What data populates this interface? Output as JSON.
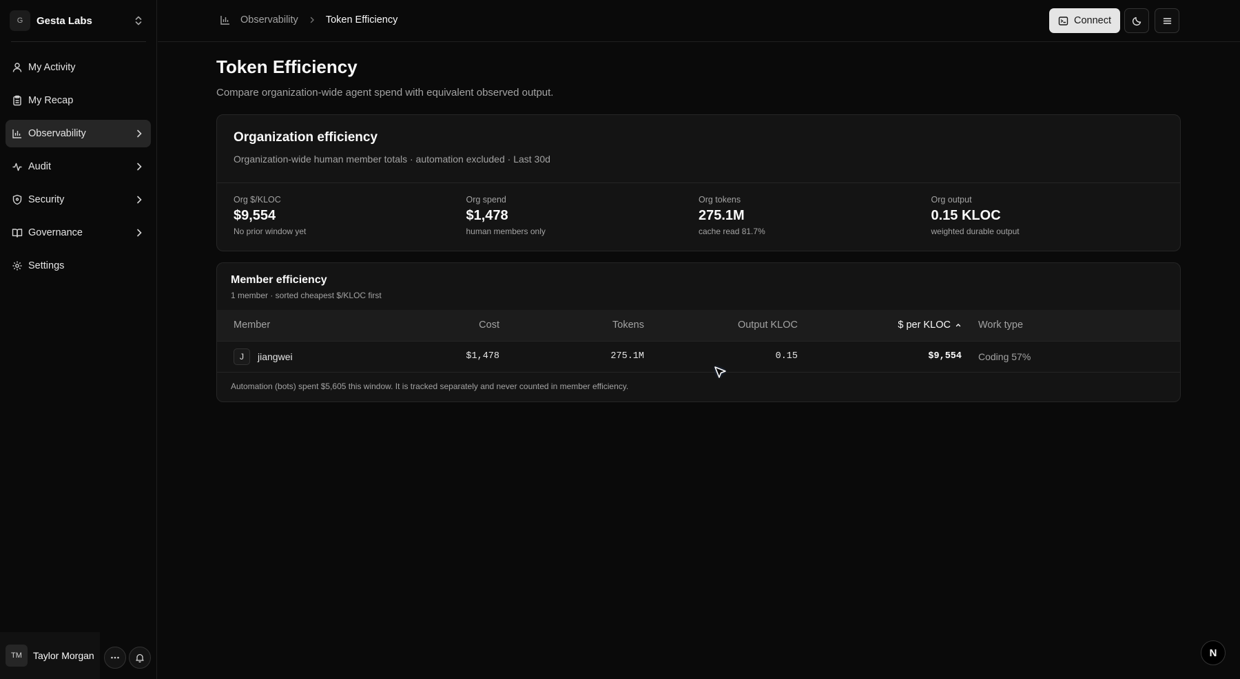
{
  "org": {
    "initial": "G",
    "name": "Gesta Labs"
  },
  "sidebar": {
    "items": [
      {
        "label": "My Activity",
        "icon": "user-icon"
      },
      {
        "label": "My Recap",
        "icon": "clipboard-icon"
      },
      {
        "label": "Observability",
        "icon": "bar-chart-icon",
        "active": true
      },
      {
        "label": "Audit",
        "icon": "activity-icon"
      },
      {
        "label": "Security",
        "icon": "shield-icon"
      },
      {
        "label": "Governance",
        "icon": "book-open-icon"
      },
      {
        "label": "Settings",
        "icon": "gear-icon"
      }
    ]
  },
  "user": {
    "initials": "TM",
    "name": "Taylor Morgan"
  },
  "breadcrumb": {
    "section": "Observability",
    "current": "Token Efficiency"
  },
  "toolbar": {
    "connect_label": "Connect"
  },
  "page": {
    "title": "Token Efficiency",
    "subtitle": "Compare organization-wide agent spend with equivalent observed output."
  },
  "org_efficiency": {
    "title": "Organization efficiency",
    "subtitle": "Organization-wide human member totals · automation excluded · Last 30d",
    "stats": [
      {
        "label": "Org $/KLOC",
        "value": "$9,554",
        "note": "No prior window yet"
      },
      {
        "label": "Org spend",
        "value": "$1,478",
        "note": "human members only"
      },
      {
        "label": "Org tokens",
        "value": "275.1M",
        "note": "cache read 81.7%"
      },
      {
        "label": "Org output",
        "value": "0.15 KLOC",
        "note": "weighted durable output"
      }
    ]
  },
  "member_efficiency": {
    "title": "Member efficiency",
    "subtitle": "1 member · sorted cheapest $/KLOC first",
    "columns": {
      "member": "Member",
      "cost": "Cost",
      "tokens": "Tokens",
      "output": "Output KLOC",
      "per_kloc": "$ per KLOC",
      "work_type": "Work type"
    },
    "rows": [
      {
        "initial": "J",
        "member": "jiangwei",
        "cost": "$1,478",
        "tokens": "275.1M",
        "output": "0.15",
        "per_kloc": "$9,554",
        "work_type": "Coding 57%"
      }
    ],
    "footer": "Automation (bots) spent $5,605 this window. It is tracked separately and never counted in member efficiency."
  },
  "corner_badge": "N"
}
